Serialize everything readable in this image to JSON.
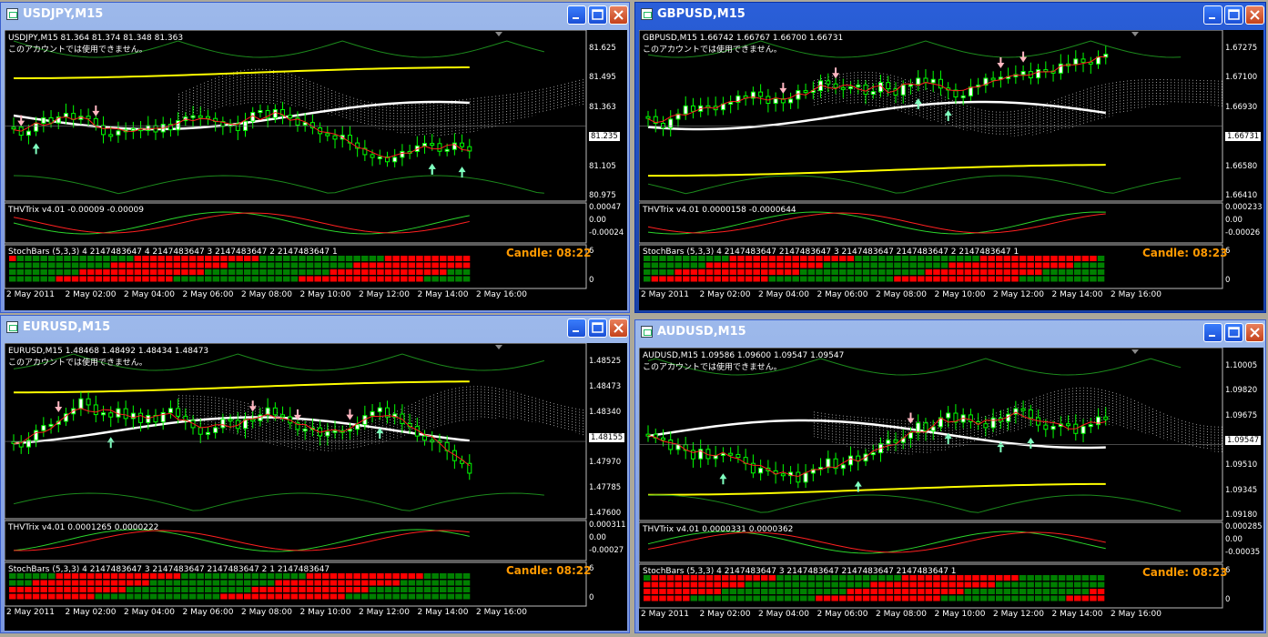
{
  "windows": [
    {
      "title": "USDJPY,M15",
      "info": "USDJPY,M15  81.364 81.374 81.348 81.363",
      "notice": "このアカウントでは使用できません。",
      "prices": [
        "81.625",
        "81.495",
        "81.363",
        "81.235",
        "81.105",
        "80.975"
      ],
      "trix_label": "THVTrix v4.01 -0.00009 -0.00009",
      "trix_scale": [
        "0.00047",
        "0.00",
        "-0.00024"
      ],
      "stoch_label": "StochBars (5,3,3) 4 2147483647 4 2147483647 3 2147483647 2 2147483647 1",
      "stoch_scale": [
        "6",
        "0"
      ],
      "candle": "Candle:  08:22",
      "times": [
        "2 May 2011",
        "2 May 02:00",
        "2 May 04:00",
        "2 May 06:00",
        "2 May 08:00",
        "2 May 10:00",
        "2 May 12:00",
        "2 May 14:00",
        "2 May 16:00"
      ]
    },
    {
      "title": "GBPUSD,M15",
      "info": "GBPUSD,M15  1.66742 1.66767 1.66700 1.66731",
      "notice": "このアカウントでは使用できません。",
      "prices": [
        "1.67275",
        "1.67100",
        "1.66930",
        "1.66731",
        "1.66580",
        "1.66410"
      ],
      "trix_label": "THVTrix v4.01 0.0000158 -0.0000644",
      "trix_scale": [
        "0.000233",
        "0.00",
        "-0.00026"
      ],
      "stoch_label": "StochBars (5,3,3) 4 2147483647 2147483647 3 2147483647 2147483647 2 2147483647 1",
      "stoch_scale": [
        "6",
        "0"
      ],
      "candle": "Candle:  08:23",
      "times": [
        "2 May 2011",
        "2 May 02:00",
        "2 May 04:00",
        "2 May 06:00",
        "2 May 08:00",
        "2 May 10:00",
        "2 May 12:00",
        "2 May 14:00",
        "2 May 16:00"
      ]
    },
    {
      "title": "EURUSD,M15",
      "info": "EURUSD,M15  1.48468 1.48492 1.48434 1.48473",
      "notice": "このアカウントでは使用できません。",
      "prices": [
        "1.48525",
        "1.48473",
        "1.48340",
        "1.48155",
        "1.47970",
        "1.47785",
        "1.47600"
      ],
      "trix_label": "THVTrix v4.01 0.0001265 0.0000222",
      "trix_scale": [
        "0.000311",
        "0.00",
        "-0.00027"
      ],
      "stoch_label": "StochBars (5,3,3) 4 2147483647 3 2147483647 2147483647 2 1 2147483647",
      "stoch_scale": [
        "6",
        "0"
      ],
      "candle": "Candle:  08:22",
      "times": [
        "2 May 2011",
        "2 May 02:00",
        "2 May 04:00",
        "2 May 06:00",
        "2 May 08:00",
        "2 May 10:00",
        "2 May 12:00",
        "2 May 14:00",
        "2 May 16:00"
      ]
    },
    {
      "title": "AUDUSD,M15",
      "info": "AUDUSD,M15  1.09586 1.09600 1.09547 1.09547",
      "notice": "このアカウントでは使用できません。",
      "prices": [
        "1.10005",
        "1.09820",
        "1.09675",
        "1.09547",
        "1.09510",
        "1.09345",
        "1.09180"
      ],
      "trix_label": "THVTrix v4.01 0.0000331 0.0000362",
      "trix_scale": [
        "0.000285",
        "0.00",
        "-0.00035"
      ],
      "stoch_label": "StochBars (5,3,3) 4 2147483647 3 2147483647 2147483647 2147483647 1",
      "stoch_scale": [
        "6",
        "0"
      ],
      "candle": "Candle:  08:23",
      "times": [
        "2 May 2011",
        "2 May 02:00",
        "2 May 04:00",
        "2 May 06:00",
        "2 May 08:00",
        "2 May 10:00",
        "2 May 12:00",
        "2 May 14:00",
        "2 May 16:00"
      ]
    }
  ]
}
